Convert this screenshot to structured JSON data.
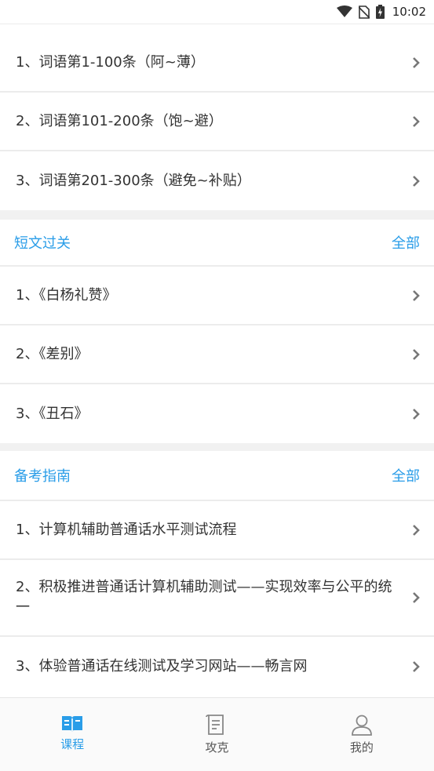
{
  "status_bar": {
    "time": "10:02"
  },
  "sections": {
    "words": {
      "items": [
        {
          "label": "1、词语第1-100条（阿~薄）"
        },
        {
          "label": "2、词语第101-200条（饱~避）"
        },
        {
          "label": "3、词语第201-300条（避免~补贴）"
        }
      ]
    },
    "short": {
      "title": "短文过关",
      "all_label": "全部",
      "items": [
        {
          "label": "1、《白杨礼赞》"
        },
        {
          "label": "2、《差别》"
        },
        {
          "label": "3、《丑石》"
        }
      ]
    },
    "guide": {
      "title": "备考指南",
      "all_label": "全部",
      "items": [
        {
          "label": "1、计算机辅助普通话水平测试流程"
        },
        {
          "label": "2、积极推进普通话计算机辅助测试——实现效率与公平的统一"
        },
        {
          "label": "3、体验普通话在线测试及学习网站——畅言网"
        }
      ]
    }
  },
  "bottom_nav": {
    "items": [
      {
        "label": "课程",
        "icon": "book-icon",
        "active": true
      },
      {
        "label": "攻克",
        "icon": "document-icon",
        "active": false
      },
      {
        "label": "我的",
        "icon": "person-icon",
        "active": false
      }
    ]
  },
  "colors": {
    "accent": "#2a9de8",
    "text": "#333333",
    "divider": "#ececec",
    "section_gap": "#f1f1f1"
  }
}
